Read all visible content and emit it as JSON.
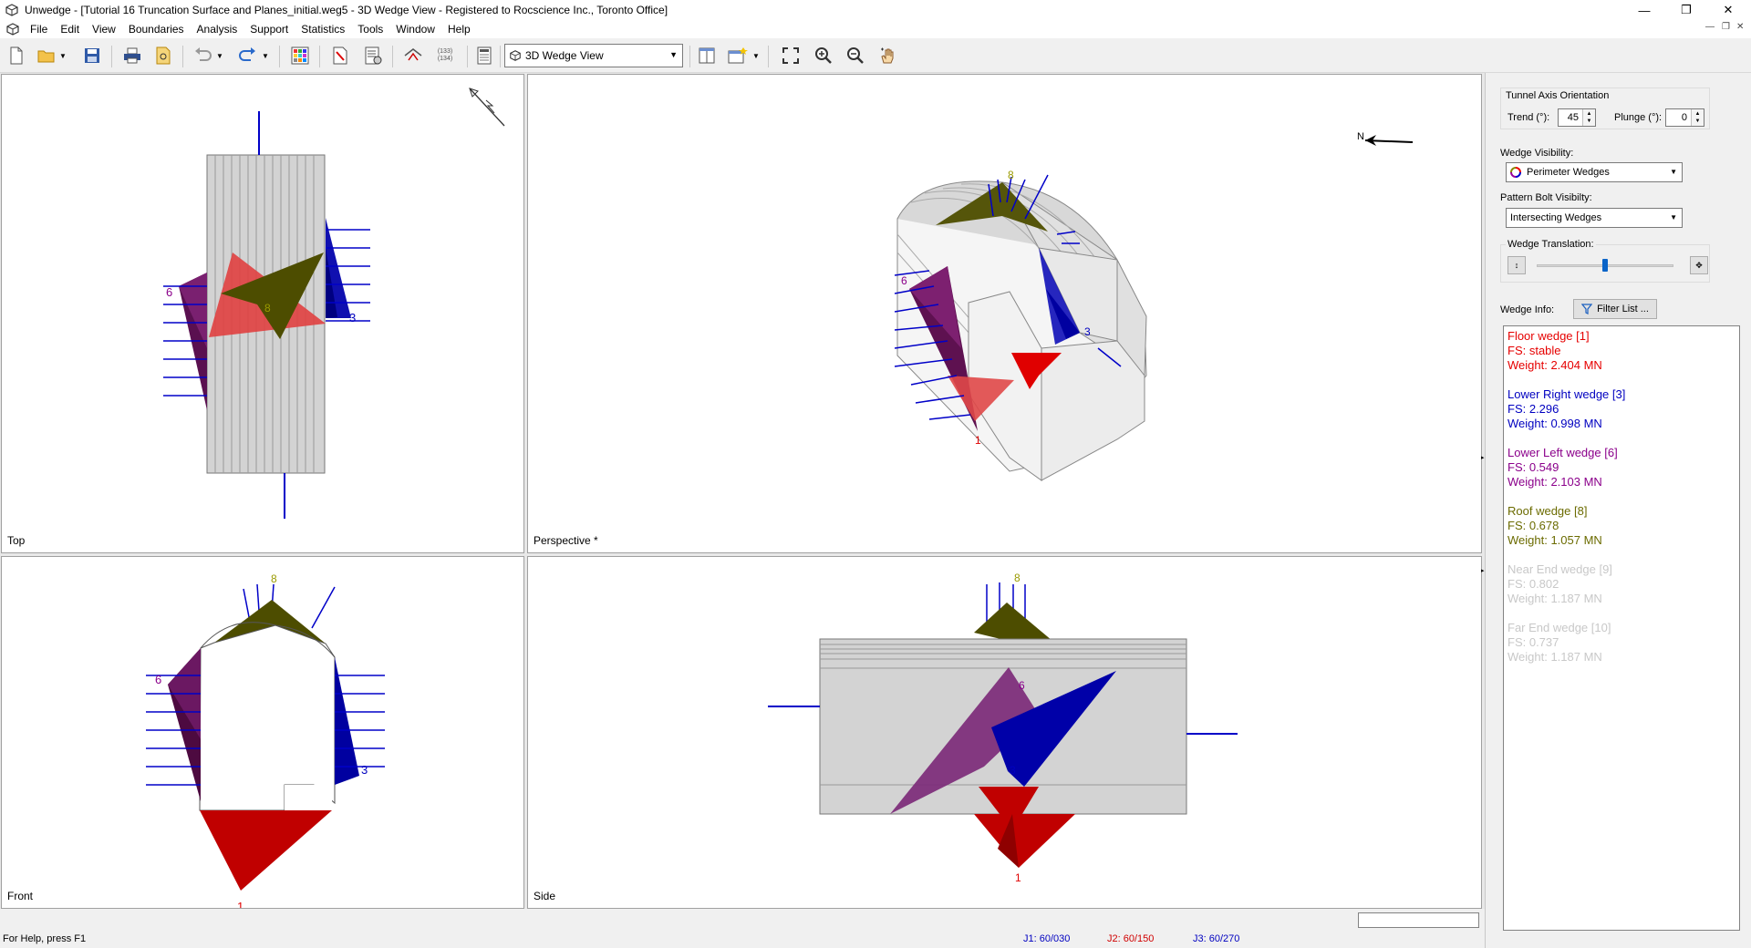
{
  "window": {
    "title": "Unwedge - [Tutorial 16 Truncation Surface and Planes_initial.weg5 - 3D Wedge View - Registered to Rocscience Inc., Toronto Office]"
  },
  "menu": [
    "File",
    "Edit",
    "View",
    "Boundaries",
    "Analysis",
    "Support",
    "Statistics",
    "Tools",
    "Window",
    "Help"
  ],
  "toolbar": {
    "view_select": "3D Wedge View",
    "bolt_icon_text": "(133)\n(134)"
  },
  "viewports": {
    "top": {
      "label": "Top"
    },
    "perspective": {
      "label": "Perspective *",
      "north": "N"
    },
    "front": {
      "label": "Front"
    },
    "side": {
      "label": "Side"
    }
  },
  "wedge_numbers": {
    "w1": "1",
    "w3": "3",
    "w6": "6",
    "w8": "8"
  },
  "colors": {
    "floor": "#e60000",
    "lower_right": "#0000c0",
    "lower_left": "#8b008b",
    "roof": "#5a5a00",
    "faded": "#c8c8c8"
  },
  "panel": {
    "tunnel_axis_title": "Tunnel Axis Orientation",
    "trend_label": "Trend (°):",
    "trend_value": "45",
    "plunge_label": "Plunge (°):",
    "plunge_value": "0",
    "wedge_visibility_label": "Wedge Visibility:",
    "wedge_visibility_value": "Perimeter Wedges",
    "bolt_visibility_label": "Pattern Bolt Visibilty:",
    "bolt_visibility_value": "Intersecting Wedges",
    "translation_label": "Wedge Translation:",
    "translation_level": 0.5,
    "wedge_info_label": "Wedge Info:",
    "filter_button": "Filter List ..."
  },
  "wedges": [
    {
      "name": "Floor wedge [1]",
      "fs": "FS: stable",
      "weight": "Weight: 2.404 MN",
      "color": "#e60000"
    },
    {
      "name": "Lower Right wedge [3]",
      "fs": "FS: 2.296",
      "weight": "Weight: 0.998 MN",
      "color": "#0000c0"
    },
    {
      "name": "Lower Left wedge [6]",
      "fs": "FS: 0.549",
      "weight": "Weight: 2.103 MN",
      "color": "#8b008b"
    },
    {
      "name": "Roof wedge [8]",
      "fs": "FS: 0.678",
      "weight": "Weight: 1.057 MN",
      "color": "#6b6b00"
    },
    {
      "name": "Near End wedge [9]",
      "fs": "FS: 0.802",
      "weight": "Weight: 1.187 MN",
      "color": "#c8c8c8"
    },
    {
      "name": "Far End wedge [10]",
      "fs": "FS: 0.737",
      "weight": "Weight: 1.187 MN",
      "color": "#c8c8c8"
    }
  ],
  "status": {
    "help": "For Help, press F1",
    "j1": "J1: 60/030",
    "j2": "J2: 60/150",
    "j3": "J3: 60/270"
  }
}
